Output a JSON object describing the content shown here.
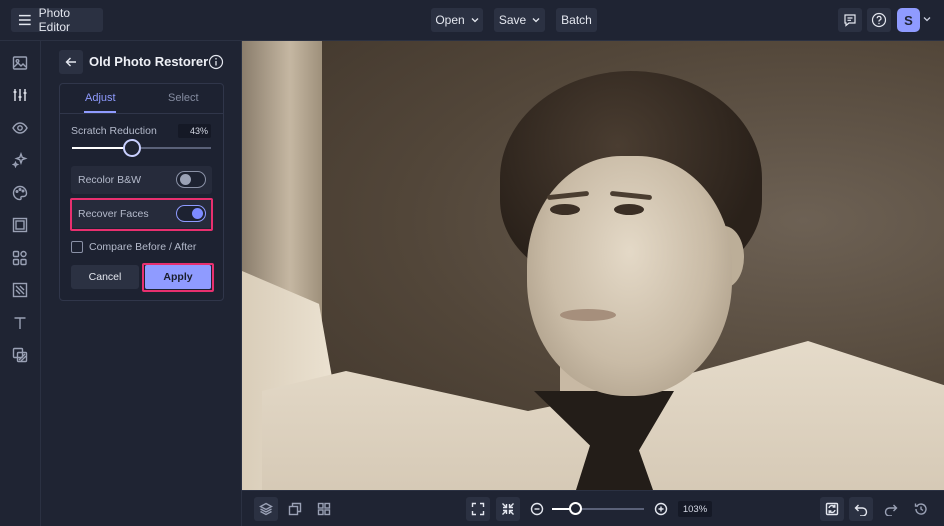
{
  "app": {
    "title": "Photo Editor",
    "menu_icon": "hamburger-icon"
  },
  "toolbar": {
    "open_label": "Open",
    "save_label": "Save",
    "batch_label": "Batch",
    "user_initial": "S"
  },
  "rail": {
    "icons": [
      "image-icon",
      "sliders-icon",
      "eye-icon",
      "sparkle-icon",
      "palette-icon",
      "frame-icon",
      "shapes-icon",
      "texture-icon",
      "text-icon",
      "overlay-icon"
    ]
  },
  "panel": {
    "title": "Old Photo Restorer",
    "tabs": [
      {
        "label": "Adjust",
        "active": true
      },
      {
        "label": "Select",
        "active": false
      }
    ],
    "scratch_reduction": {
      "label": "Scratch Reduction",
      "value_text": "43%",
      "value": 43
    },
    "recolor": {
      "label": "Recolor B&W",
      "enabled": false
    },
    "recover_faces": {
      "label": "Recover Faces",
      "enabled": true
    },
    "compare": {
      "label": "Compare Before / After",
      "checked": false
    },
    "cancel_label": "Cancel",
    "apply_label": "Apply"
  },
  "bottom_bar": {
    "zoom_text": "103%",
    "zoom_value": 103
  },
  "colors": {
    "accent": "#8f9bff",
    "highlight": "#e8306f",
    "background": "#1c2130"
  }
}
